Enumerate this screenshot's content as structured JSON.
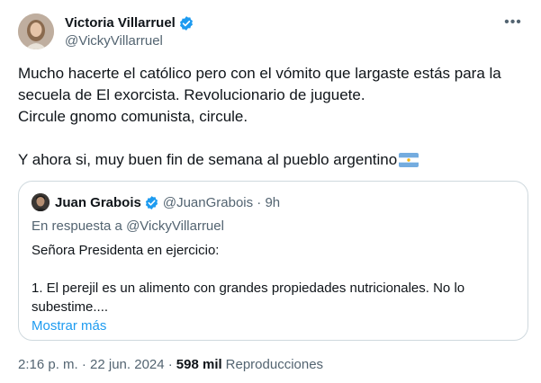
{
  "author": {
    "display_name": "Victoria Villarruel",
    "handle": "@VickyVillarruel",
    "verified": true
  },
  "more_label": "•••",
  "tweet_text": "Mucho hacerte el católico pero con el vómito que largaste estás para la\nsecuela de El exorcista. Revolucionario de juguete.\nCircule gnomo comunista, circule.\n\nY ahora si, muy buen fin de semana al pueblo argentino",
  "flag_icon": "argentina-flag-icon",
  "quoted": {
    "display_name": "Juan Grabois",
    "handle_time": "@JuanGrabois · 9h",
    "verified": true,
    "reply_prefix": "En respuesta a",
    "reply_mention": "@VickyVillarruel",
    "text": "Señora Presidenta en ejercicio:\n\n1. El perejil es un alimento con grandes propiedades nutricionales. No lo\nsubestime....",
    "show_more": "Mostrar más"
  },
  "meta": {
    "time_date": "2:16 p. m. · 22 jun. 2024 ·",
    "views_count": "598 mil",
    "views_label": "Reproducciones"
  },
  "colors": {
    "verified": "#1d9bf0",
    "link": "#1d9bf0",
    "secondary": "#536471",
    "border": "#cfd9de"
  }
}
